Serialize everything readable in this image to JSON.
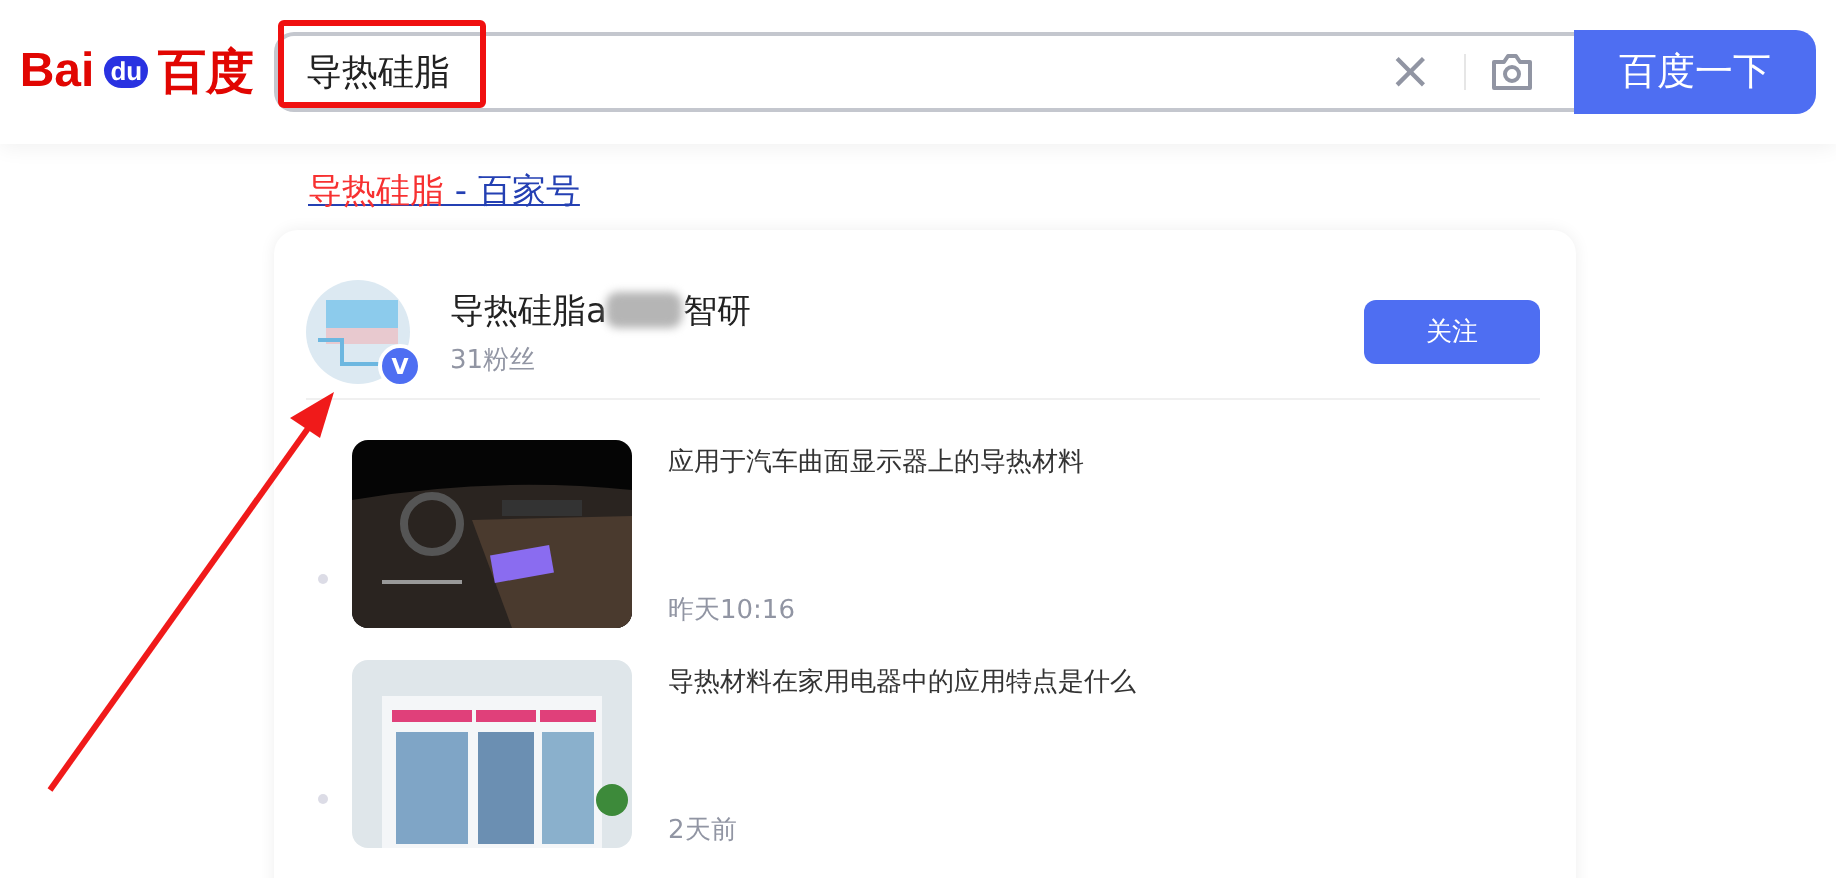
{
  "header": {
    "logo": {
      "left": "Bai",
      "middle": "du",
      "right": "百度"
    },
    "search": {
      "value": "导热硅脂",
      "clear": "×"
    },
    "submit": "百度一下"
  },
  "result": {
    "title_highlight": "导热硅脂",
    "title_rest": " - 百家号"
  },
  "account": {
    "name_start": "导热硅脂a",
    "name_end": "智研",
    "verified": true,
    "badge": "V",
    "fans": "31粉丝",
    "follow": "关注"
  },
  "articles": [
    {
      "title": "应用于汽车曲面显示器上的导热材料",
      "time": "昨天10:16",
      "kind": "picture"
    },
    {
      "title": "导热材料在家用电器中的应用特点是什么",
      "time": "2天前",
      "kind": "picture"
    }
  ],
  "annotations": {
    "highlight_box": true,
    "arrow": true
  }
}
